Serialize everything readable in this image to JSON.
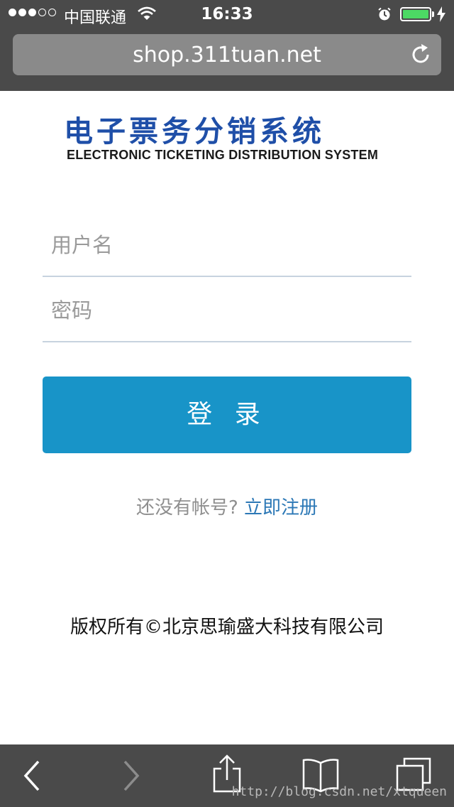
{
  "status_bar": {
    "carrier": "中国联通",
    "time": "16:33",
    "battery_level": 1.0,
    "signal_strength": 3
  },
  "browser": {
    "url": "shop.311tuan.net"
  },
  "logo": {
    "title_cn": "电子票务分销系统",
    "title_en": "ELECTRONIC TICKETING DISTRIBUTION SYSTEM"
  },
  "form": {
    "username_placeholder": "用户名",
    "password_placeholder": "密码",
    "login_label": "登 录"
  },
  "register": {
    "prompt": "还没有帐号?",
    "link": "立即注册"
  },
  "footer": {
    "copyright": "版权所有©北京思瑜盛大科技有限公司"
  },
  "watermark": "http://blog.csdn.net/xtqueen",
  "colors": {
    "accent": "#1894c8",
    "link": "#2c78b6",
    "logo_blue": "#1f4fa8",
    "chrome": "#4a4a4a"
  }
}
